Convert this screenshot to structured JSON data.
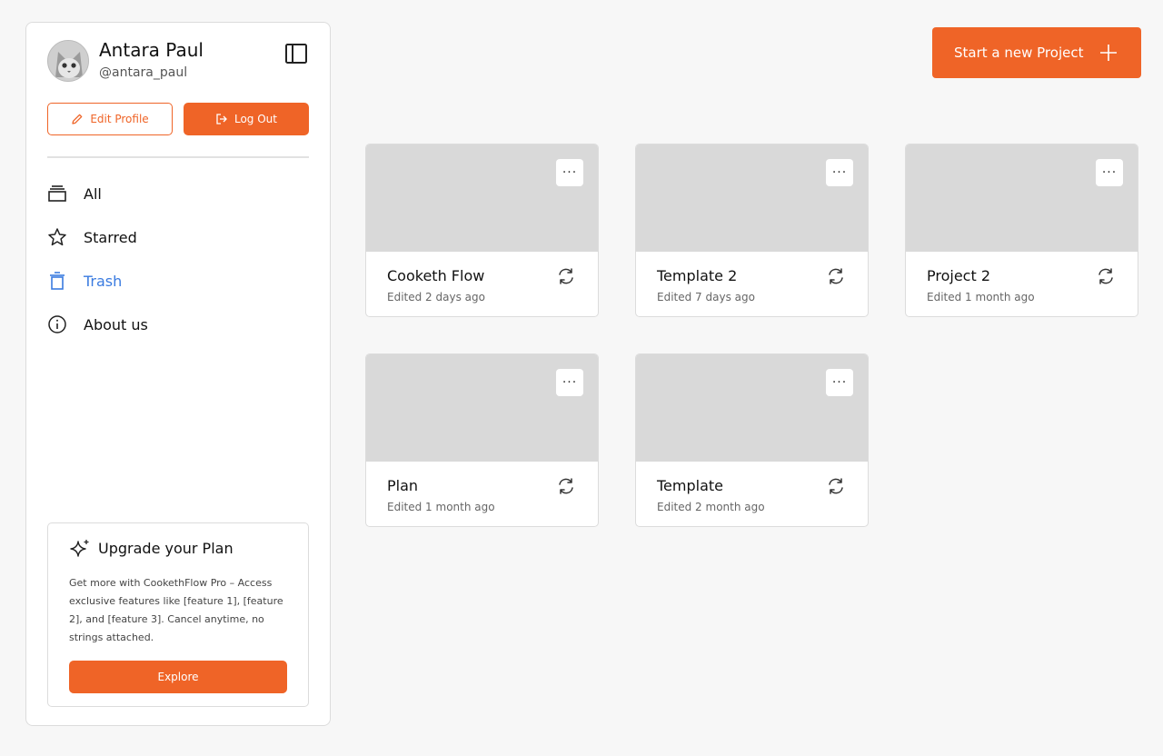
{
  "profile": {
    "name": "Antara Paul",
    "handle": "@antara_paul",
    "edit_label": "Edit Profile",
    "logout_label": "Log Out"
  },
  "nav": {
    "items": [
      {
        "label": "All",
        "icon": "stack-icon"
      },
      {
        "label": "Starred",
        "icon": "star-icon"
      },
      {
        "label": "Trash",
        "icon": "trash-icon",
        "active": true
      },
      {
        "label": "About us",
        "icon": "info-icon"
      }
    ]
  },
  "upgrade": {
    "title": "Upgrade your Plan",
    "text": "Get more with CookethFlow Pro – Access exclusive features like [feature 1], [feature 2], and [feature 3]. Cancel anytime, no strings attached.",
    "button": "Explore"
  },
  "header": {
    "new_project_label": "Start a new Project"
  },
  "projects": [
    {
      "title": "Cooketh Flow",
      "edited": "Edited 2 days ago"
    },
    {
      "title": "Template 2",
      "edited": "Edited 7 days ago"
    },
    {
      "title": "Project 2",
      "edited": "Edited 1 month ago"
    },
    {
      "title": "Plan",
      "edited": "Edited 1 month ago"
    },
    {
      "title": "Template",
      "edited": "Edited 2 month ago"
    }
  ],
  "colors": {
    "accent": "#ef6427",
    "active_nav": "#3a7be0",
    "thumbnail": "#d9d9d9"
  }
}
